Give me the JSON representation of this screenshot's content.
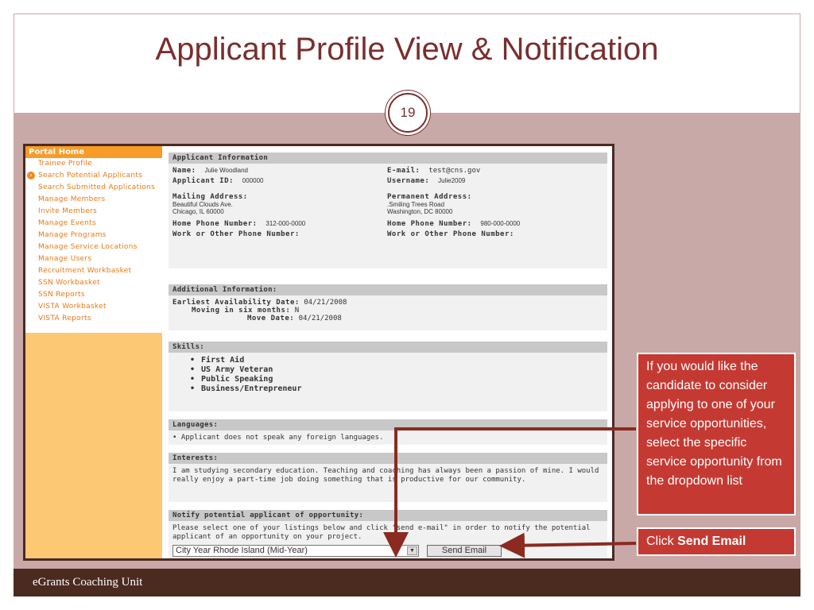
{
  "slide": {
    "title": "Applicant Profile View & Notification",
    "number": "19",
    "footer": "eGrants Coaching Unit"
  },
  "sidebar": {
    "header": "Portal Home",
    "items": [
      {
        "label": "Trainee Profile"
      },
      {
        "label": "Search Potential Applicants",
        "active": true
      },
      {
        "label": "Search Submitted Applications"
      },
      {
        "label": "Manage Members"
      },
      {
        "label": "Invite Members"
      },
      {
        "label": "Manage Events"
      },
      {
        "label": "Manage Programs"
      },
      {
        "label": "Manage Service Locations"
      },
      {
        "label": "Manage Users"
      },
      {
        "label": "Recruitment Workbasket"
      },
      {
        "label": "SSN Workbasket"
      },
      {
        "label": "SSN Reports"
      },
      {
        "label": "VISTA Workbasket"
      },
      {
        "label": "VISTA Reports"
      }
    ]
  },
  "applicant": {
    "section_title": "Applicant Information",
    "name_label": "Name:",
    "name": "Julie Woodland",
    "email_label": "E-mail:",
    "email": "test@cns.gov",
    "id_label": "Applicant ID:",
    "id": "000000",
    "username_label": "Username:",
    "username": "Julie2009",
    "mailing_label": "Mailing Address:",
    "mailing_line1": "Beautiful Clouds Ave.",
    "mailing_line2": "Chicago, IL 60000",
    "permanent_label": "Permanent Address:",
    "permanent_line1": ".Smiling Trees Road",
    "permanent_line2": "Washington, DC 80000",
    "home_phone_label": "Home Phone Number:",
    "home_phone": "312-000-0000",
    "perm_home_phone_label": "Home Phone Number:",
    "perm_home_phone": "980-000-0000",
    "work_phone_label": "Work or Other Phone Number:",
    "perm_work_phone_label": "Work or Other Phone Number:"
  },
  "additional": {
    "section_title": "Additional Information:",
    "earliest_label": "Earliest Availability Date:",
    "earliest": "04/21/2008",
    "moving_label": "Moving in six months:",
    "moving": "N",
    "move_date_label": "Move Date:",
    "move_date": "04/21/2008"
  },
  "skills": {
    "section_title": "Skills:",
    "items": [
      "First Aid",
      "US Army Veteran",
      "Public Speaking",
      "Business/Entrepreneur"
    ]
  },
  "languages": {
    "section_title": "Languages:",
    "text": "• Applicant does not speak any foreign languages."
  },
  "interests": {
    "section_title": "Interests:",
    "text": "I am studying secondary education. Teaching and coaching has always been a passion of mine. I would really enjoy a part-time job doing something that is productive for our community."
  },
  "notify": {
    "section_title": "Notify potential applicant of opportunity:",
    "instructions": "Please select one of your listings below and click \"send e-mail\" in order to notify the potential applicant of an opportunity on your project.",
    "selected_listing": "City Year Rhode Island (Mid-Year)",
    "send_label": "Send Email"
  },
  "callouts": {
    "dropdown_tip": "If you would like the candidate to consider applying to one of your service opportunities, select the specific service opportunity from the dropdown list",
    "send_prefix": "Click ",
    "send_bold": "Send Email"
  },
  "colors": {
    "title": "#7a2e2e",
    "band": "#c9a9a7",
    "footer": "#4b2a20",
    "callout": "#c43a33",
    "sidebar_head": "#f99b27",
    "sidebar_link": "#e67a14",
    "sidebar_fill": "#fdc873",
    "arrow": "#8b2a20"
  }
}
